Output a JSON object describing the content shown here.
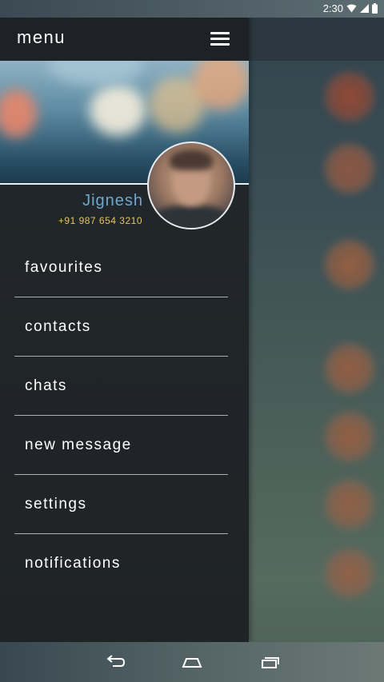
{
  "status_bar": {
    "time": "2:30",
    "icons": [
      "wifi-icon",
      "signal-icon",
      "battery-icon"
    ]
  },
  "drawer": {
    "title": "menu",
    "menu_icon": "hamburger-menu-icon",
    "profile": {
      "name": "Jignesh",
      "phone": "+91 987 654 3210"
    },
    "items": [
      {
        "label": "favourites"
      },
      {
        "label": "contacts"
      },
      {
        "label": "chats"
      },
      {
        "label": "new message"
      },
      {
        "label": "settings"
      },
      {
        "label": "notifications"
      }
    ]
  },
  "nav_bar": {
    "buttons": [
      "back-icon",
      "home-icon",
      "recent-apps-icon"
    ]
  },
  "colors": {
    "drawer_bg": "#22272b",
    "name_color": "#6fa8cf",
    "phone_color": "#e6c45f",
    "divider": "#a9b0b4"
  }
}
